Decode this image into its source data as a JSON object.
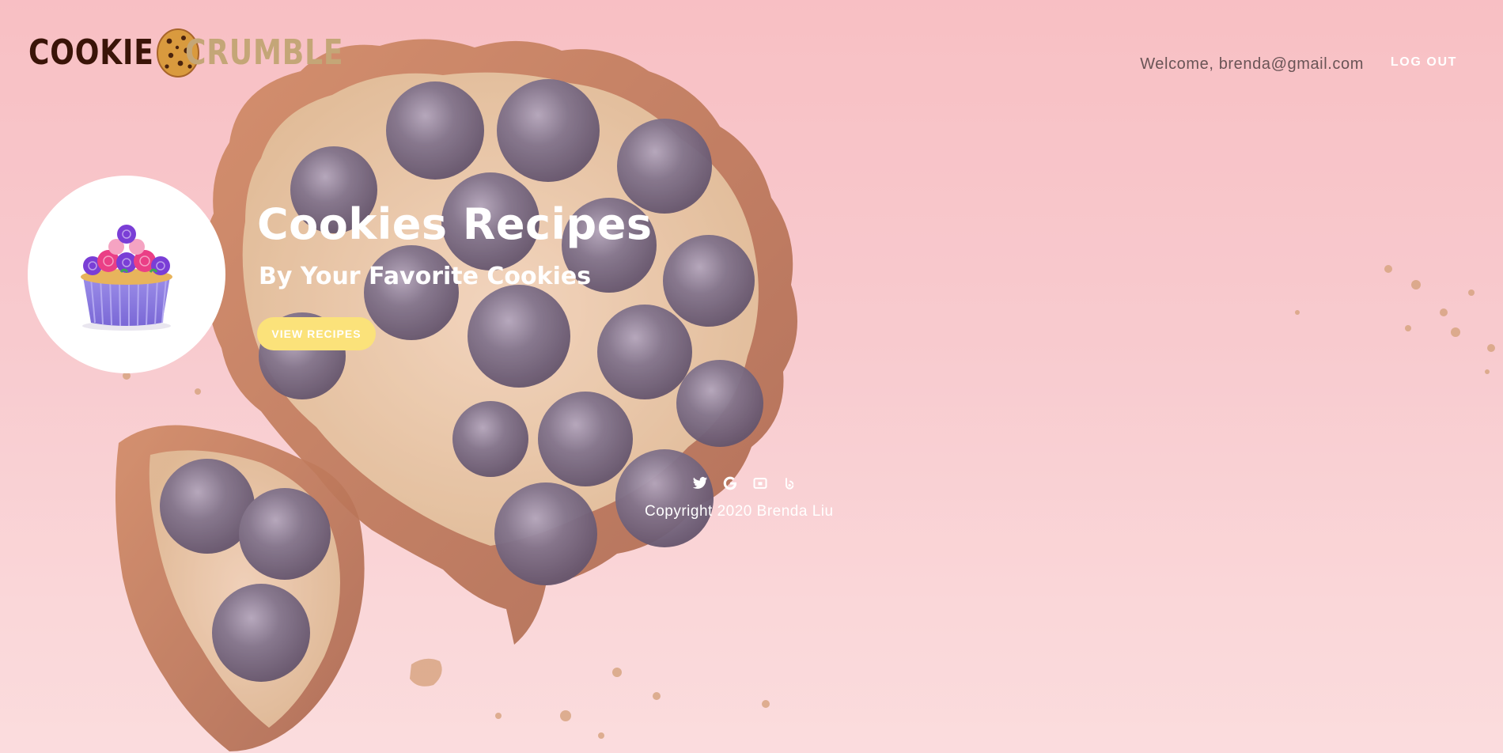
{
  "brand": {
    "name_part1": "COOKIE",
    "name_part2": "CRUMBLE",
    "icon": "cookie-icon",
    "colors": {
      "dark": "#3a1408",
      "light": "#c4a677"
    }
  },
  "nav": {
    "welcome_text": "Welcome, brenda@gmail.com",
    "logout_label": "LOG OUT"
  },
  "hero": {
    "title": "Cookies Recipes",
    "subtitle": "By Your Favorite Cookies",
    "button_label": "VIEW RECIPES",
    "button_color": "#fbe27a",
    "avatar_image": "cupcake-image",
    "background_image": "blueberry-tart-image"
  },
  "footer": {
    "social": [
      {
        "icon": "twitter-icon"
      },
      {
        "icon": "google-icon"
      },
      {
        "icon": "youtube-icon"
      },
      {
        "icon": "blogger-icon"
      }
    ],
    "copyright": "Copyright 2020 Brenda Liu"
  },
  "colors": {
    "background_top": "#f8c3c6",
    "background_bottom": "#fcebea",
    "text_light": "#ffffff"
  }
}
